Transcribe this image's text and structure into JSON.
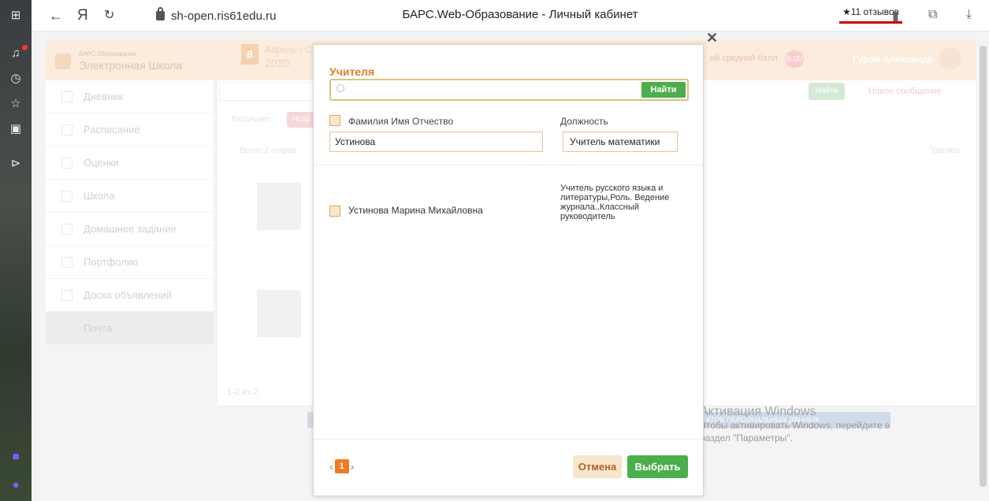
{
  "browser": {
    "url": "sh-open.ris61edu.ru",
    "page_title": "БАРС.Web-Образование - Личный кабинет",
    "reviews": "★11 отзывов"
  },
  "app": {
    "logo_top": "БАРС.Образование",
    "logo_main": "Электронная Школа",
    "date_num": "8",
    "date_text": "Апрель / С",
    "year": "2020",
    "avg_label": "ий средний балл",
    "avg_value": "0.00",
    "user": "Гуров Александр",
    "search_btn": "Найти",
    "new_msg": "Новое сообщение",
    "tab_inbox": "Входящие",
    "tab_sent": "Испр",
    "total": "Всего: 2 отправ",
    "delete": "Удалить",
    "pager": "1-2 из 2",
    "footer_banner": "ЕКТОВ ПЕРСОНАЛЬНЫХ ДАННЫХ",
    "sidebar": [
      {
        "label": "Дневник"
      },
      {
        "label": "Расписание"
      },
      {
        "label": "Оценки"
      },
      {
        "label": "Школа"
      },
      {
        "label": "Домашнее задание"
      },
      {
        "label": "Портфолио"
      },
      {
        "label": "Доска объявлений"
      },
      {
        "label": "Почта"
      }
    ]
  },
  "modal": {
    "title": "Учителя",
    "search_placeholder": "",
    "find_label": "Найти",
    "col_name": "Фамилия Имя Отчество",
    "col_position": "Должность",
    "name_filter": "Устинова",
    "position_filter": "Учитель математики",
    "rows": [
      {
        "name": "Устинова Марина Михайловна",
        "position": "Учитель русского языка и литературы,Роль. Ведение журнала.,Классный руководитель"
      }
    ],
    "page": "1",
    "cancel_label": "Отмена",
    "select_label": "Выбрать"
  },
  "windows_activation": {
    "title": "Активация Windows",
    "line1": "Чтобы активировать Windows, перейдите в",
    "line2": "раздел \"Параметры\"."
  }
}
